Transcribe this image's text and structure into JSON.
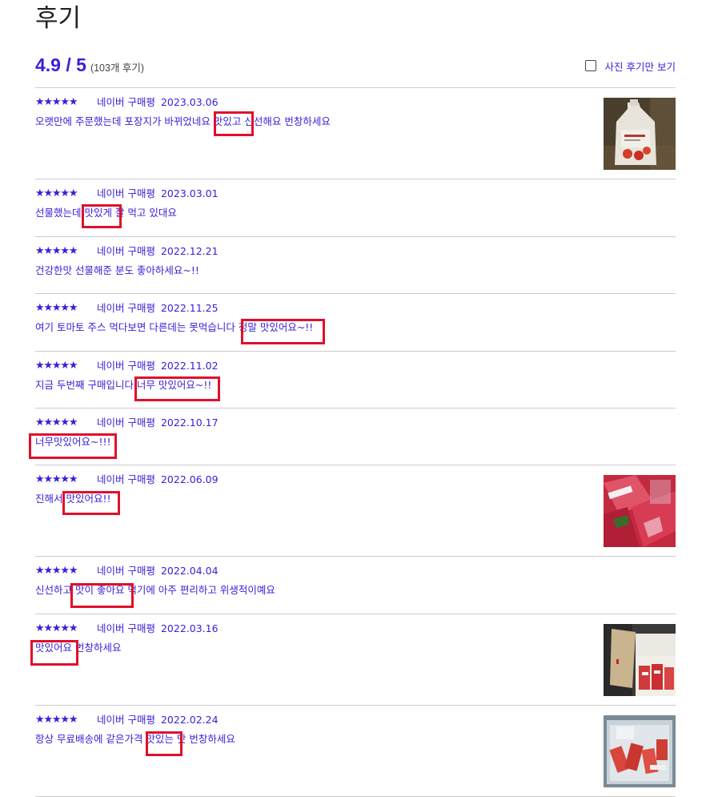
{
  "page": {
    "title": "후기"
  },
  "summary": {
    "score": "4.9 / 5",
    "count": "(103개 후기)",
    "photo_only_label": "사진 후기만 보기",
    "photo_only_checked": false
  },
  "colors": {
    "text_accent": "#3a20d8",
    "highlight_box": "#e0102b",
    "divider": "#cccccc"
  },
  "reviews": [
    {
      "stars": "★★★★★",
      "rating": 5,
      "source": "네이버 구매평",
      "date": "2023.03.06",
      "text": "오랫만에 주문했는데 포장지가 바뀌었네요 맛있고 신선해요 번창하세요",
      "highlight": "맛있고",
      "photo": "product-pouch-photo"
    },
    {
      "stars": "★★★★★",
      "rating": 5,
      "source": "네이버 구매평",
      "date": "2023.03.01",
      "text": "선물했는데 맛있게 잘 먹고 있대요",
      "highlight": "맛있게"
    },
    {
      "stars": "★★★★★",
      "rating": 5,
      "source": "네이버 구매평",
      "date": "2022.12.21",
      "text": "건강한맛 선물해준 분도 좋아하세요~!!"
    },
    {
      "stars": "★★★★★",
      "rating": 5,
      "source": "네이버 구매평",
      "date": "2022.11.25",
      "text": "여기 토마토 주스 먹다보면 다른데는 못먹습니다 정말 맛있어요~!!",
      "highlight": "정말 맛있어요~!!"
    },
    {
      "stars": "★★★★★",
      "rating": 5,
      "source": "네이버 구매평",
      "date": "2022.11.02",
      "text": "지금 두번째 구매입니다 너무 맛있어요~!!",
      "highlight": "너무 맛있어요~!!"
    },
    {
      "stars": "★★★★★",
      "rating": 5,
      "source": "네이버 구매평",
      "date": "2022.10.17",
      "text": "너무맛있어요~!!!",
      "highlight": "너무맛있어요~!!!"
    },
    {
      "stars": "★★★★★",
      "rating": 5,
      "source": "네이버 구매평",
      "date": "2022.06.09",
      "text": "진해서 맛있어요!!",
      "highlight": "맛있어요!!",
      "photo": "tomato-packs-photo"
    },
    {
      "stars": "★★★★★",
      "rating": 5,
      "source": "네이버 구매평",
      "date": "2022.04.04",
      "text": "신선하고 맛이 좋아요 먹기에 아주 편리하고 위생적이예요",
      "highlight": "맛이 좋아요"
    },
    {
      "stars": "★★★★★",
      "rating": 5,
      "source": "네이버 구매평",
      "date": "2022.03.16",
      "text": "맛있어요 번창하세요",
      "highlight": "맛있어요",
      "photo": "delivery-box-photo"
    },
    {
      "stars": "★★★★★",
      "rating": 5,
      "source": "네이버 구매평",
      "date": "2022.02.24",
      "text": "항상 무료배송에 같은가격 맛있는 맛 번창하세요",
      "highlight": "맛있는",
      "photo": "packed-box-photo"
    }
  ]
}
